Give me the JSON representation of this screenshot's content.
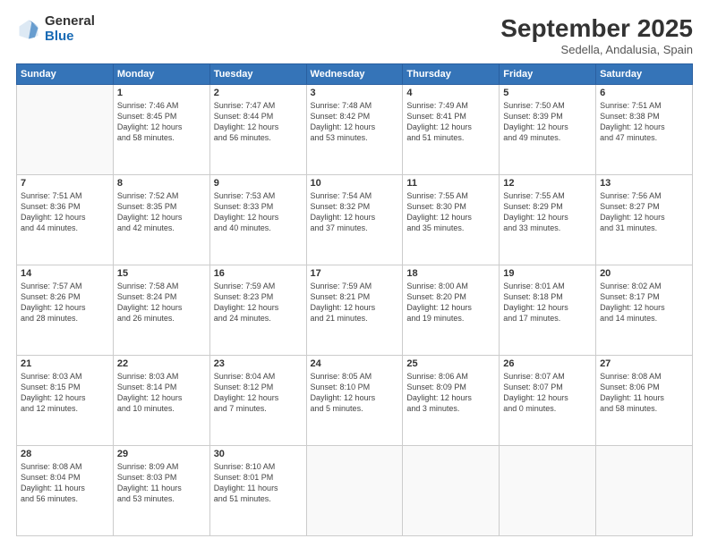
{
  "logo": {
    "general": "General",
    "blue": "Blue"
  },
  "header": {
    "month": "September 2025",
    "location": "Sedella, Andalusia, Spain"
  },
  "weekdays": [
    "Sunday",
    "Monday",
    "Tuesday",
    "Wednesday",
    "Thursday",
    "Friday",
    "Saturday"
  ],
  "weeks": [
    [
      {
        "day": "",
        "info": ""
      },
      {
        "day": "1",
        "info": "Sunrise: 7:46 AM\nSunset: 8:45 PM\nDaylight: 12 hours\nand 58 minutes."
      },
      {
        "day": "2",
        "info": "Sunrise: 7:47 AM\nSunset: 8:44 PM\nDaylight: 12 hours\nand 56 minutes."
      },
      {
        "day": "3",
        "info": "Sunrise: 7:48 AM\nSunset: 8:42 PM\nDaylight: 12 hours\nand 53 minutes."
      },
      {
        "day": "4",
        "info": "Sunrise: 7:49 AM\nSunset: 8:41 PM\nDaylight: 12 hours\nand 51 minutes."
      },
      {
        "day": "5",
        "info": "Sunrise: 7:50 AM\nSunset: 8:39 PM\nDaylight: 12 hours\nand 49 minutes."
      },
      {
        "day": "6",
        "info": "Sunrise: 7:51 AM\nSunset: 8:38 PM\nDaylight: 12 hours\nand 47 minutes."
      }
    ],
    [
      {
        "day": "7",
        "info": "Sunrise: 7:51 AM\nSunset: 8:36 PM\nDaylight: 12 hours\nand 44 minutes."
      },
      {
        "day": "8",
        "info": "Sunrise: 7:52 AM\nSunset: 8:35 PM\nDaylight: 12 hours\nand 42 minutes."
      },
      {
        "day": "9",
        "info": "Sunrise: 7:53 AM\nSunset: 8:33 PM\nDaylight: 12 hours\nand 40 minutes."
      },
      {
        "day": "10",
        "info": "Sunrise: 7:54 AM\nSunset: 8:32 PM\nDaylight: 12 hours\nand 37 minutes."
      },
      {
        "day": "11",
        "info": "Sunrise: 7:55 AM\nSunset: 8:30 PM\nDaylight: 12 hours\nand 35 minutes."
      },
      {
        "day": "12",
        "info": "Sunrise: 7:55 AM\nSunset: 8:29 PM\nDaylight: 12 hours\nand 33 minutes."
      },
      {
        "day": "13",
        "info": "Sunrise: 7:56 AM\nSunset: 8:27 PM\nDaylight: 12 hours\nand 31 minutes."
      }
    ],
    [
      {
        "day": "14",
        "info": "Sunrise: 7:57 AM\nSunset: 8:26 PM\nDaylight: 12 hours\nand 28 minutes."
      },
      {
        "day": "15",
        "info": "Sunrise: 7:58 AM\nSunset: 8:24 PM\nDaylight: 12 hours\nand 26 minutes."
      },
      {
        "day": "16",
        "info": "Sunrise: 7:59 AM\nSunset: 8:23 PM\nDaylight: 12 hours\nand 24 minutes."
      },
      {
        "day": "17",
        "info": "Sunrise: 7:59 AM\nSunset: 8:21 PM\nDaylight: 12 hours\nand 21 minutes."
      },
      {
        "day": "18",
        "info": "Sunrise: 8:00 AM\nSunset: 8:20 PM\nDaylight: 12 hours\nand 19 minutes."
      },
      {
        "day": "19",
        "info": "Sunrise: 8:01 AM\nSunset: 8:18 PM\nDaylight: 12 hours\nand 17 minutes."
      },
      {
        "day": "20",
        "info": "Sunrise: 8:02 AM\nSunset: 8:17 PM\nDaylight: 12 hours\nand 14 minutes."
      }
    ],
    [
      {
        "day": "21",
        "info": "Sunrise: 8:03 AM\nSunset: 8:15 PM\nDaylight: 12 hours\nand 12 minutes."
      },
      {
        "day": "22",
        "info": "Sunrise: 8:03 AM\nSunset: 8:14 PM\nDaylight: 12 hours\nand 10 minutes."
      },
      {
        "day": "23",
        "info": "Sunrise: 8:04 AM\nSunset: 8:12 PM\nDaylight: 12 hours\nand 7 minutes."
      },
      {
        "day": "24",
        "info": "Sunrise: 8:05 AM\nSunset: 8:10 PM\nDaylight: 12 hours\nand 5 minutes."
      },
      {
        "day": "25",
        "info": "Sunrise: 8:06 AM\nSunset: 8:09 PM\nDaylight: 12 hours\nand 3 minutes."
      },
      {
        "day": "26",
        "info": "Sunrise: 8:07 AM\nSunset: 8:07 PM\nDaylight: 12 hours\nand 0 minutes."
      },
      {
        "day": "27",
        "info": "Sunrise: 8:08 AM\nSunset: 8:06 PM\nDaylight: 11 hours\nand 58 minutes."
      }
    ],
    [
      {
        "day": "28",
        "info": "Sunrise: 8:08 AM\nSunset: 8:04 PM\nDaylight: 11 hours\nand 56 minutes."
      },
      {
        "day": "29",
        "info": "Sunrise: 8:09 AM\nSunset: 8:03 PM\nDaylight: 11 hours\nand 53 minutes."
      },
      {
        "day": "30",
        "info": "Sunrise: 8:10 AM\nSunset: 8:01 PM\nDaylight: 11 hours\nand 51 minutes."
      },
      {
        "day": "",
        "info": ""
      },
      {
        "day": "",
        "info": ""
      },
      {
        "day": "",
        "info": ""
      },
      {
        "day": "",
        "info": ""
      }
    ]
  ]
}
